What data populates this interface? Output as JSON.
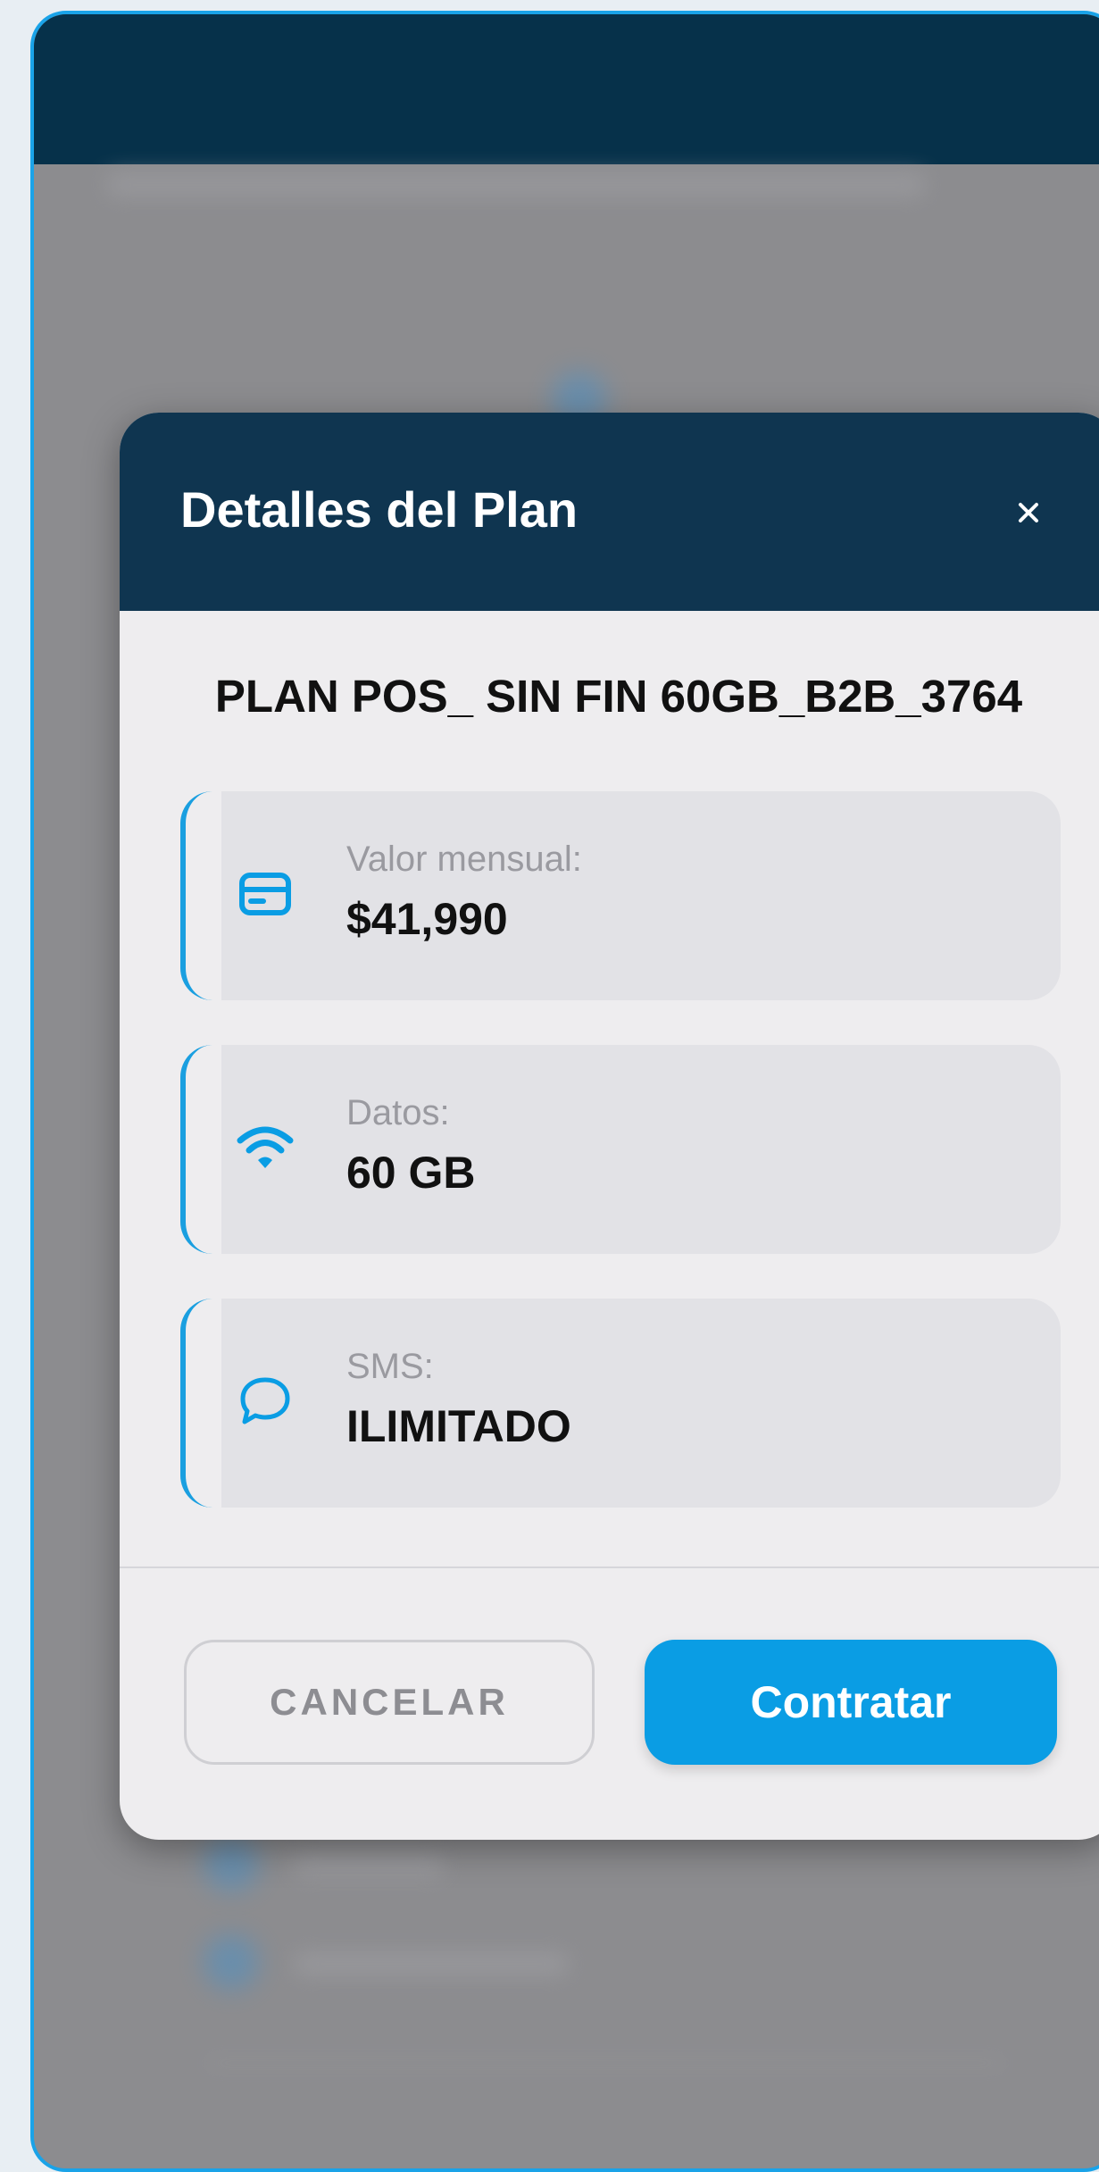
{
  "modal": {
    "title": "Detalles del Plan",
    "close_label": "×",
    "plan_name": "PLAN POS_ SIN FIN 60GB_B2B_3764",
    "items": [
      {
        "icon": "credit-card-icon",
        "label": "Valor mensual:",
        "value": "$41,990"
      },
      {
        "icon": "wifi-icon",
        "label": "Datos:",
        "value": "60 GB"
      },
      {
        "icon": "chat-bubble-icon",
        "label": "SMS:",
        "value": "ILIMITADO"
      }
    ],
    "cancel_label": "CANCELAR",
    "confirm_label": "Contratar"
  },
  "colors": {
    "accent": "#0a9de4",
    "header": "#0f3550",
    "app_header": "#06314a",
    "frame_border": "#1aa3e8"
  }
}
